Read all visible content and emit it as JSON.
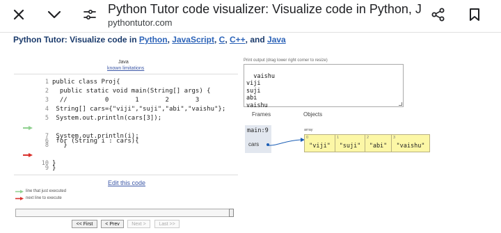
{
  "browser": {
    "title": "Python Tutor code visualizer: Visualize code in Python, Ja…",
    "domain": "pythontutor.com"
  },
  "header": {
    "prefix": "Python Tutor: Visualize code in ",
    "links": [
      "Python",
      "JavaScript",
      "C",
      "C++",
      "Java"
    ],
    "sep1": ", ",
    "sep_last": ", and "
  },
  "editor": {
    "language": "Java",
    "limitations": "known limitations",
    "lines": [
      {
        "n": "1",
        "code": "public class Proj{"
      },
      {
        "n": "2",
        "code": "  public static void main(String[] args) {"
      },
      {
        "n": "3",
        "code": "  //          0       1       2       3"
      },
      {
        "n": "4",
        "code": " String[] cars={\"viji\",\"suji\",\"abi\",\"vaishu\"};"
      },
      {
        "n": "5",
        "code": " System.out.println(cars[3]);"
      },
      {
        "n": "6",
        "code": " for (String i : cars){"
      },
      {
        "n": "7",
        "code": " System.out.println(i);"
      },
      {
        "n": "8",
        "code": "   }"
      },
      {
        "n": "9",
        "code": "}"
      },
      {
        "n": "10",
        "code": "}"
      }
    ],
    "executed_line": 6,
    "next_line": 9,
    "edit_link": "Edit this code",
    "legend_executed": "line that just executed",
    "legend_next": "next line to execute"
  },
  "controls": {
    "first": "<< First",
    "prev": "< Prev",
    "next": "Next >",
    "last": "Last >>",
    "progress": 1.0
  },
  "output": {
    "label": "Print output (drag lower right corner to resize)",
    "text": "vaishu\nviji\nsuji\nabi\nvaishu"
  },
  "viz": {
    "frames_header": "Frames",
    "objects_header": "Objects",
    "frame_name": "main:9",
    "var_name": "cars",
    "array_label": "array",
    "array": [
      {
        "i": "0",
        "v": "\"viji\""
      },
      {
        "i": "1",
        "v": "\"suji\""
      },
      {
        "i": "2",
        "v": "\"abi\""
      },
      {
        "i": "3",
        "v": "\"vaishu\""
      }
    ]
  },
  "colors": {
    "executed_arrow": "#8fd08f",
    "next_arrow": "#d9302b",
    "array_fill": "#fcf7a6",
    "frame_fill": "#e2e7ef",
    "pointer": "#1a5db5"
  },
  "icons": [
    "close-icon",
    "chevron-down-icon",
    "tune-icon",
    "share-icon",
    "bookmark-icon"
  ]
}
